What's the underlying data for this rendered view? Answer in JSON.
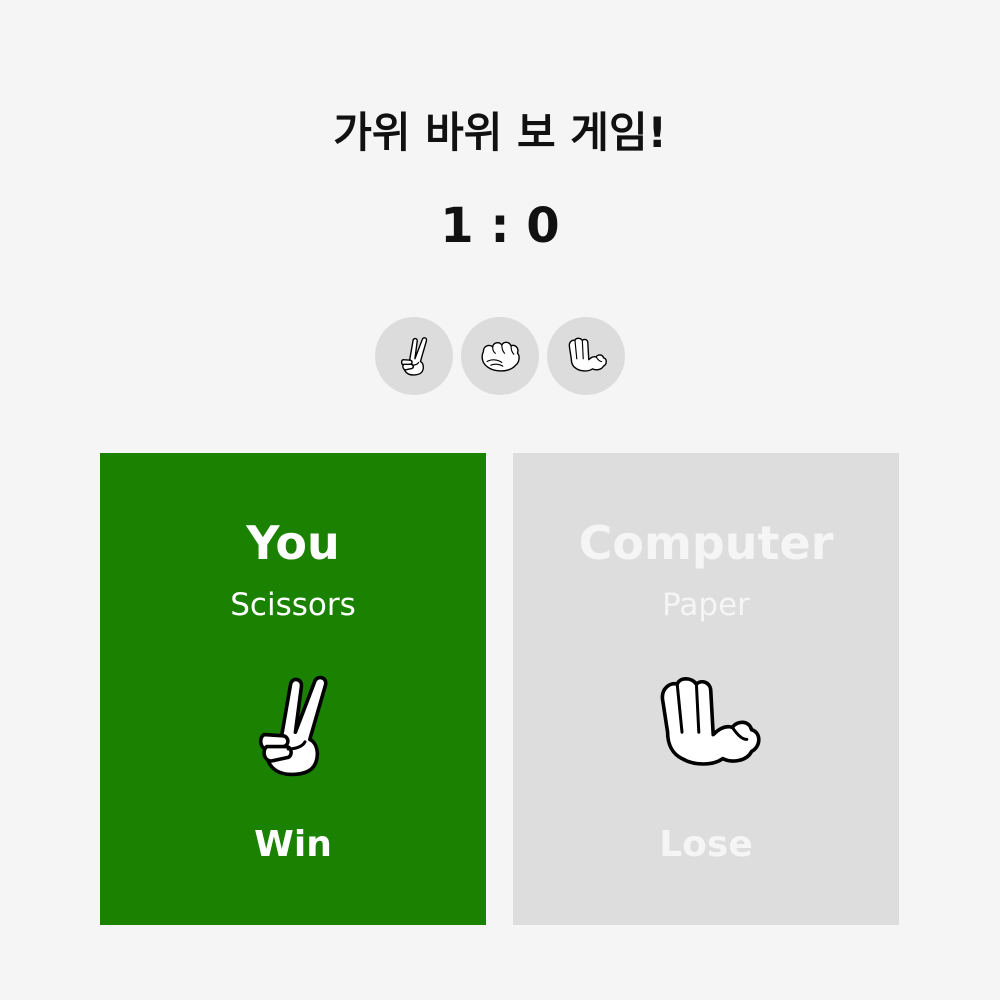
{
  "title": "가위 바위 보 게임!",
  "score": {
    "player": 1,
    "computer": 0,
    "display": "1 : 0"
  },
  "choices": [
    {
      "name": "Scissors",
      "icon": "scissors-hand-icon"
    },
    {
      "name": "Rock",
      "icon": "rock-fist-icon"
    },
    {
      "name": "Paper",
      "icon": "paper-hand-icon"
    }
  ],
  "player": {
    "label": "You",
    "choice": "Scissors",
    "icon": "scissors-hand-icon",
    "result": "Win"
  },
  "computer": {
    "label": "Computer",
    "choice": "Paper",
    "icon": "paper-hand-icon",
    "result": "Lose"
  },
  "colors": {
    "background": "#f5f5f5",
    "win_panel": "#1a8200",
    "lose_panel": "#dddddd",
    "win_text": "#ffffff",
    "lose_text": "#f5f5f5",
    "choice_button": "#dcdcdc",
    "title_text": "#111111"
  }
}
